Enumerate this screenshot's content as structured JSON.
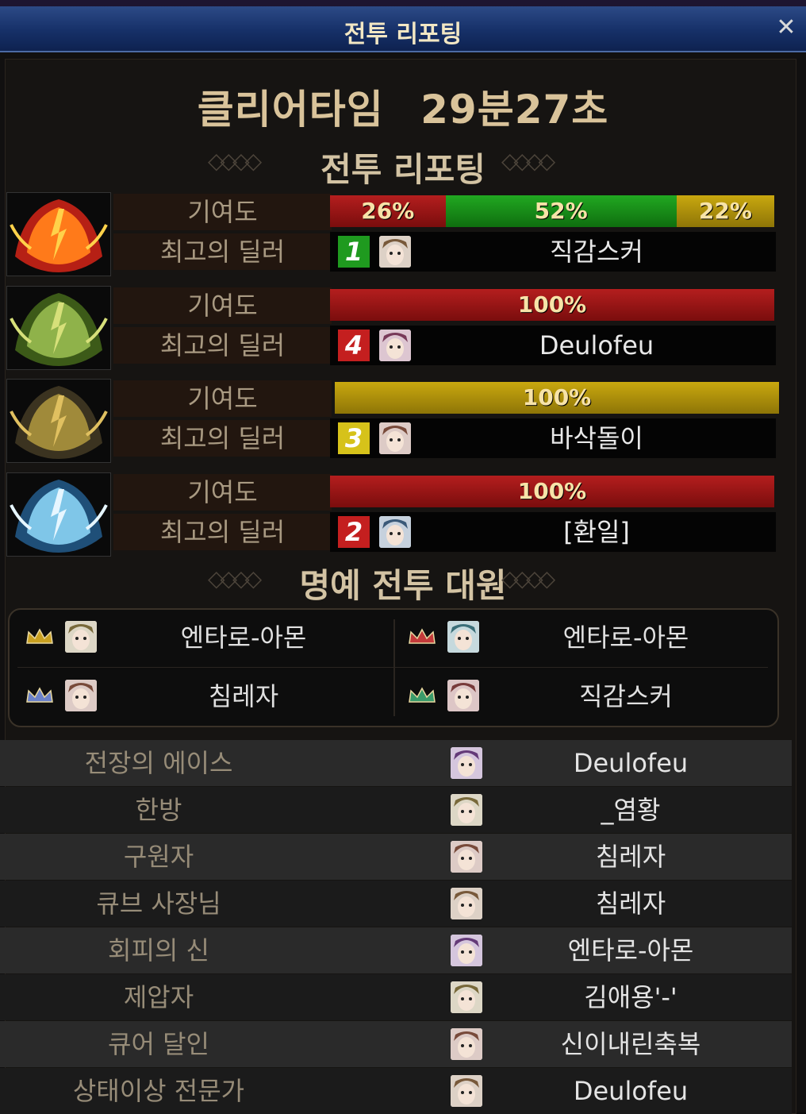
{
  "window": {
    "title": "전투 리포팅",
    "close_glyph": "✕"
  },
  "clear_time": {
    "label": "클리어타임",
    "value": "29분27초"
  },
  "section_report": "전투 리포팅",
  "section_honor": "명예 전투 대원",
  "bosses": [
    {
      "icon": "fire-boss-icon",
      "contrib_label": "기여도",
      "dealer_label": "최고의 딜러",
      "segments": [
        {
          "text": "26%",
          "value": 26,
          "color": "red"
        },
        {
          "text": "52%",
          "value": 52,
          "color": "green"
        },
        {
          "text": "22%",
          "value": 22,
          "color": "yellow"
        }
      ],
      "rank": "1",
      "rank_color": "#1f9a1f",
      "dealer": "직감스커"
    },
    {
      "icon": "nature-boss-icon",
      "contrib_label": "기여도",
      "dealer_label": "최고의 딜러",
      "segments": [
        {
          "text": "100%",
          "value": 100,
          "color": "red"
        }
      ],
      "rank": "4",
      "rank_color": "#c41f1f",
      "dealer": "Deulofeu"
    },
    {
      "icon": "dark-boss-icon",
      "contrib_label": "기여도",
      "dealer_label": "최고의 딜러",
      "segments": [
        {
          "text": "100%",
          "value": 100,
          "color": "yellow"
        }
      ],
      "rank": "3",
      "rank_color": "#d6c21a",
      "dealer": "바삭돌이"
    },
    {
      "icon": "ice-boss-icon",
      "contrib_label": "기여도",
      "dealer_label": "최고의 딜러",
      "segments": [
        {
          "text": "100%",
          "value": 100,
          "color": "red"
        }
      ],
      "rank": "2",
      "rank_color": "#c41f1f",
      "dealer": "[환일]"
    }
  ],
  "honor_members": [
    "엔타로-아몬",
    "엔타로-아몬",
    "침레자",
    "직감스커"
  ],
  "awards": [
    {
      "label": "전장의 에이스",
      "name": "Deulofeu"
    },
    {
      "label": "한방",
      "name": "_염황"
    },
    {
      "label": "구원자",
      "name": "침레자"
    },
    {
      "label": "큐브 사장님",
      "name": "침레자"
    },
    {
      "label": "회피의 신",
      "name": "엔타로-아몬"
    },
    {
      "label": "제압자",
      "name": "김애용'-'"
    },
    {
      "label": "큐어 달인",
      "name": "신이내린축복"
    },
    {
      "label": "상태이상 전문가",
      "name": "Deulofeu"
    }
  ]
}
